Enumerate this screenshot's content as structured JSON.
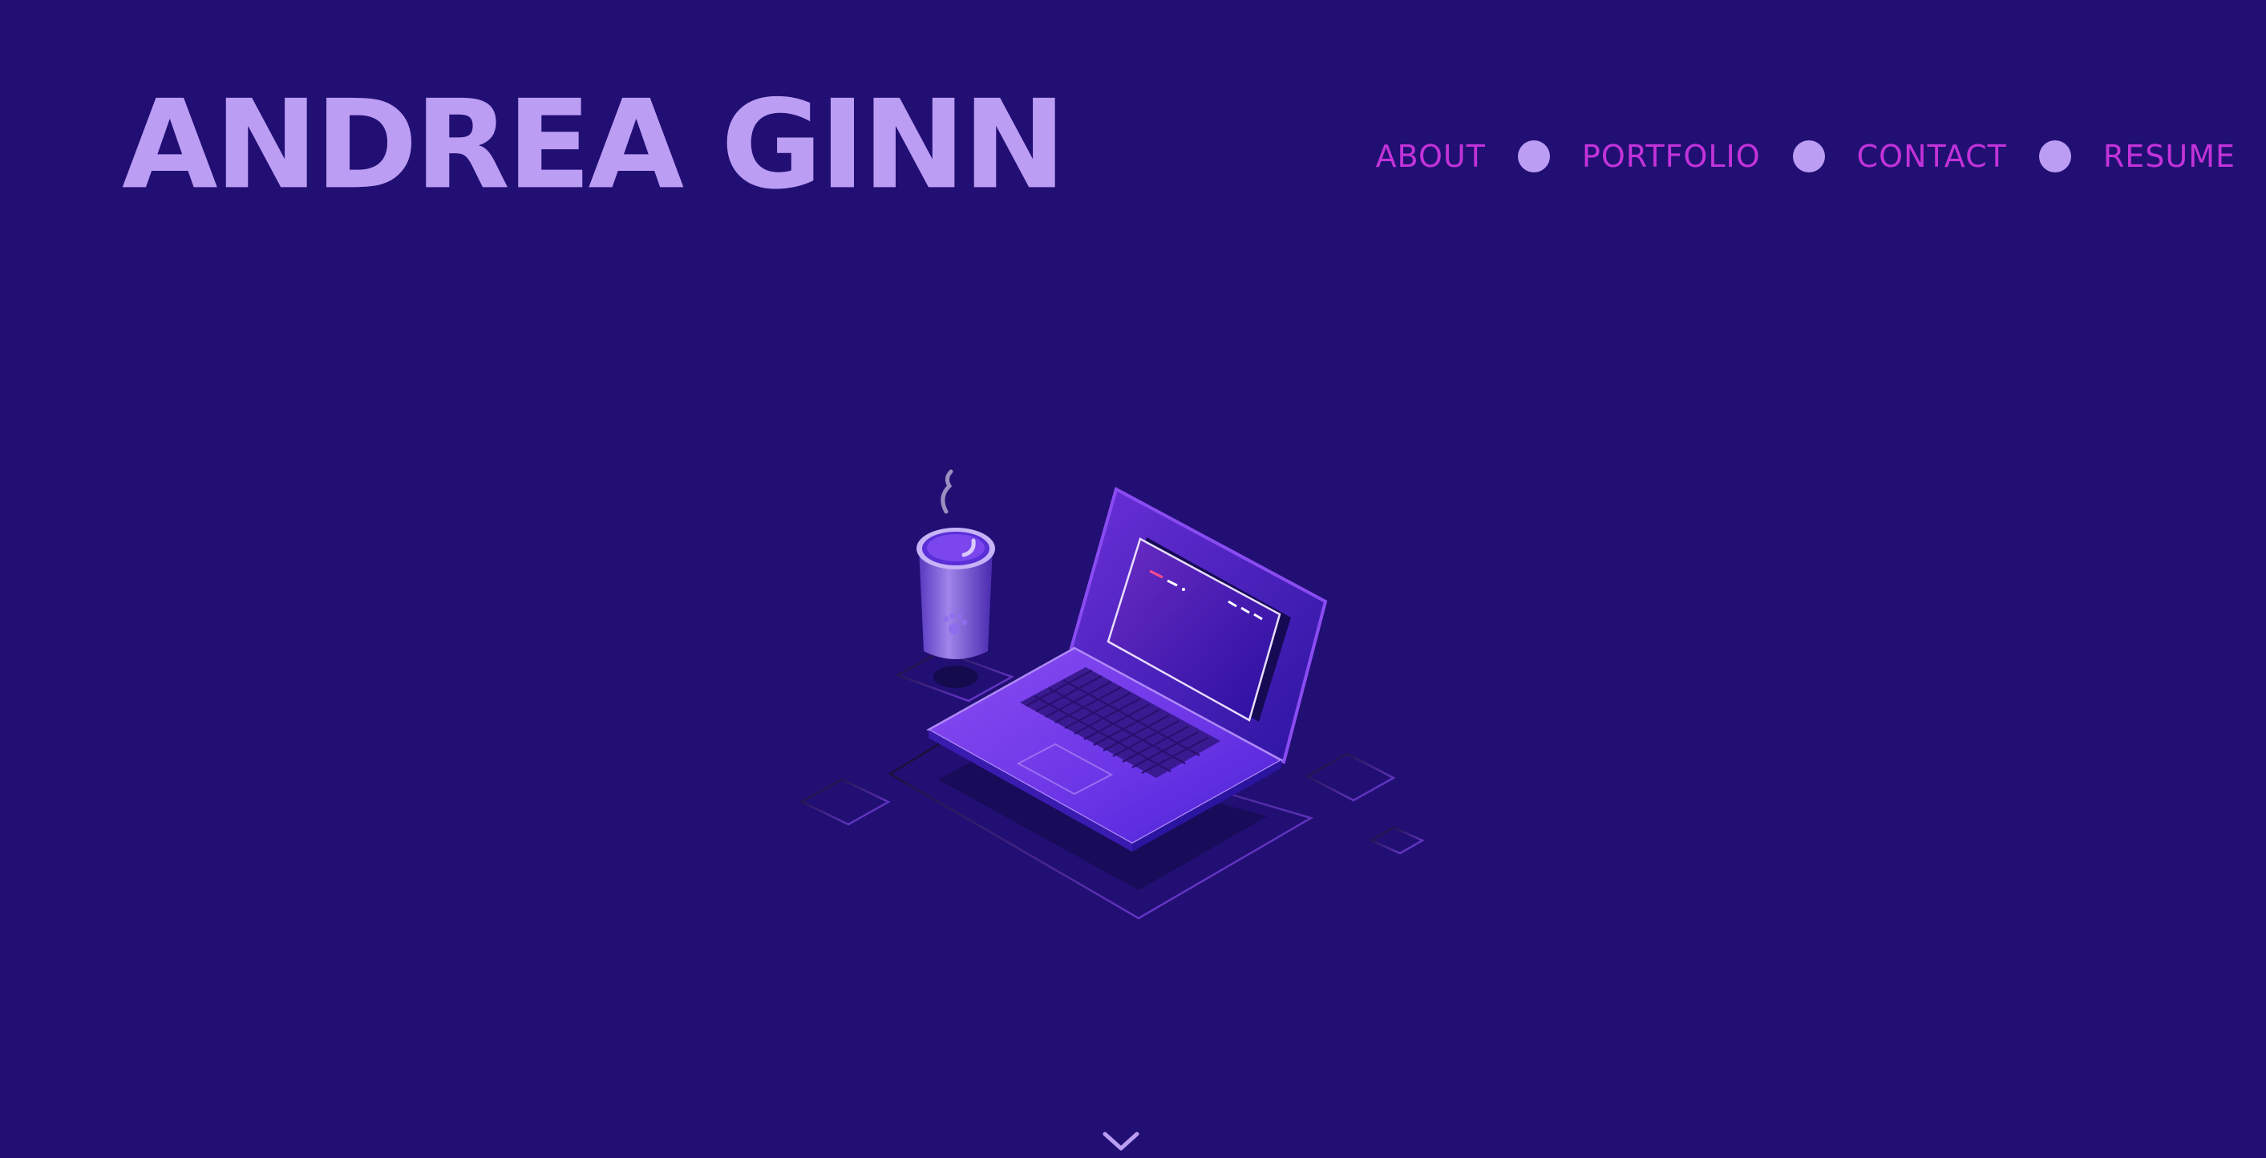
{
  "header": {
    "logo_text": "ANDREA GINN"
  },
  "nav": {
    "items": [
      {
        "label": "ABOUT"
      },
      {
        "label": "PORTFOLIO"
      },
      {
        "label": "CONTACT"
      },
      {
        "label": "RESUME"
      }
    ]
  },
  "hero": {
    "illustration": "isometric-laptop-and-coffee-cup"
  },
  "footer": {
    "scroll_icon": "chevron-down-icon"
  },
  "colors": {
    "background": "#220f73",
    "logo": "#bb9df4",
    "nav_link": "#c233d9",
    "nav_dot": "#bb9df4",
    "accent_purple": "#7b3ff0"
  }
}
